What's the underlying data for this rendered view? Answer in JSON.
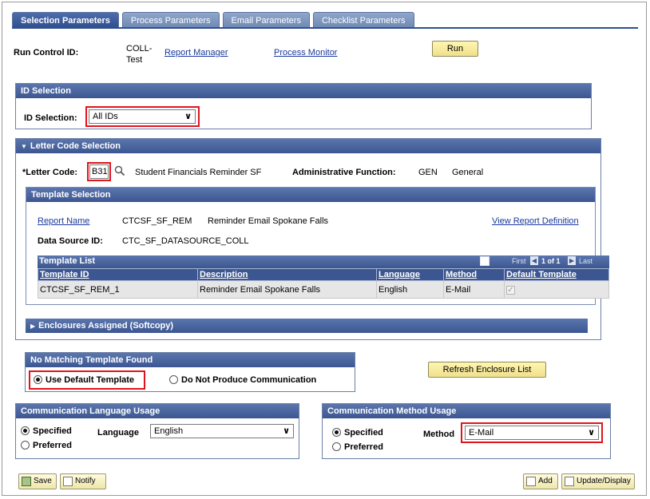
{
  "tabs": [
    {
      "label": "Selection Parameters"
    },
    {
      "label": "Process Parameters"
    },
    {
      "label": "Email Parameters"
    },
    {
      "label": "Checklist Parameters"
    }
  ],
  "run_control": {
    "label": "Run Control ID:",
    "value_line1": "COLL-",
    "value_line2": "Test",
    "report_manager": "Report Manager",
    "process_monitor": "Process Monitor",
    "run_button": "Run"
  },
  "id_selection": {
    "header": "ID Selection",
    "label": "ID Selection:",
    "value": "All IDs"
  },
  "letter_code": {
    "header": "Letter Code Selection",
    "label": "*Letter Code:",
    "value": "B31",
    "description": "Student Financials Reminder SF",
    "admin_label": "Administrative Function:",
    "admin_code": "GEN",
    "admin_desc": "General"
  },
  "template_selection": {
    "header": "Template Selection",
    "report_name_link": "Report Name",
    "report_code": "CTCSF_SF_REM",
    "report_desc": "Reminder Email Spokane Falls",
    "view_definition": "View Report Definition",
    "datasource_label": "Data Source ID:",
    "datasource_value": "CTC_SF_DATASOURCE_COLL"
  },
  "template_list": {
    "header": "Template List",
    "nav": {
      "first": "First",
      "range": "1 of 1",
      "last": "Last"
    },
    "columns": [
      "Template ID",
      "Description",
      "Language",
      "Method",
      "Default Template"
    ],
    "rows": [
      {
        "template_id": "CTCSF_SF_REM_1",
        "description": "Reminder Email Spokane Falls",
        "language": "English",
        "method": "E-Mail",
        "default": "✓"
      }
    ]
  },
  "enclosures": {
    "header": "Enclosures Assigned (Softcopy)"
  },
  "no_match": {
    "header": "No Matching Template Found",
    "opt_default": "Use Default Template",
    "opt_none": "Do Not Produce Communication"
  },
  "refresh_button": "Refresh Enclosure List",
  "comm_language": {
    "header": "Communication Language Usage",
    "specified": "Specified",
    "preferred": "Preferred",
    "language_label": "Language",
    "language_value": "English"
  },
  "comm_method": {
    "header": "Communication Method Usage",
    "specified": "Specified",
    "preferred": "Preferred",
    "method_label": "Method",
    "method_value": "E-Mail"
  },
  "toolbar": {
    "save": "Save",
    "notify": "Notify",
    "add": "Add",
    "update_display": "Update/Display"
  },
  "colors": {
    "header_blue": "#3c5692",
    "highlight_red": "#e0141e",
    "run_button_yellow": "#f0e08c"
  }
}
